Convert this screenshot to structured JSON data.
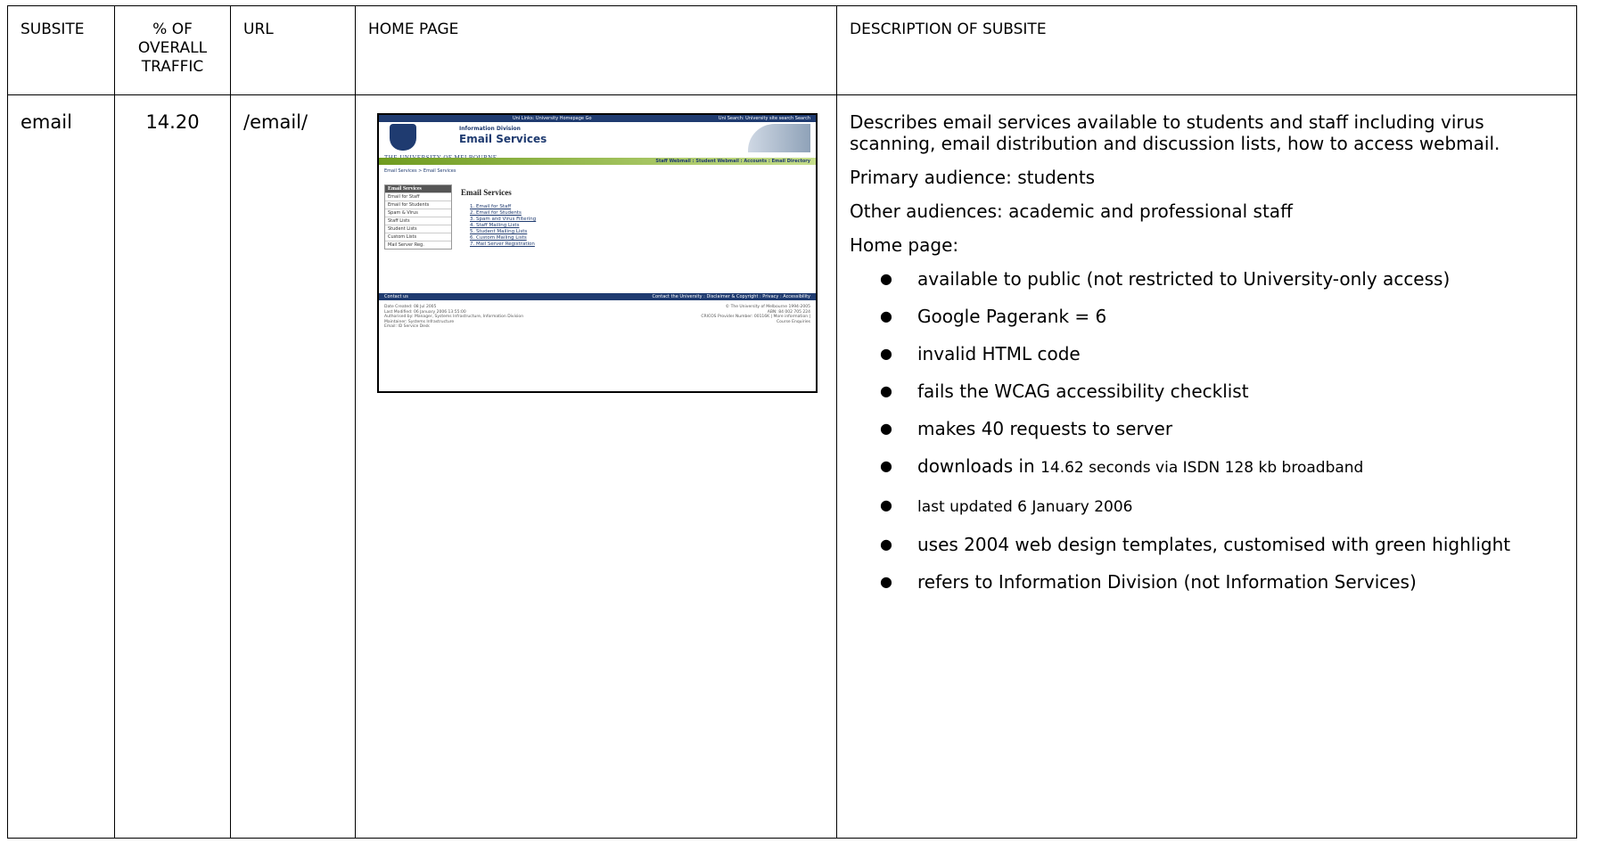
{
  "headers": {
    "subsite": "SUBSITE",
    "traffic_line1": "% OF",
    "traffic_line2": "OVERALL",
    "traffic_line3": "TRAFFIC",
    "url": "URL",
    "home_page": "HOME PAGE",
    "description": "DESCRIPTION OF SUBSITE"
  },
  "row": {
    "subsite": "email",
    "traffic": "14.20",
    "url": "/email/",
    "description": {
      "intro": "Describes email services available to students and staff including virus scanning, email distribution and discussion lists, how to access webmail.",
      "primary": "Primary audience: students",
      "other": "Other audiences: academic and professional staff",
      "home_label": "Home page:",
      "bullets": [
        "available to public (not restricted to University-only access)",
        "Google Pagerank = 6",
        "invalid HTML code",
        "fails the WCAG accessibility checklist",
        "makes 40 requests to server"
      ],
      "download_prefix": "downloads in",
      "download_detail": "14.62 seconds via ISDN 128 kb broadband",
      "last_updated": "last updated 6 January 2006",
      "bullets_after": [
        "uses 2004 web design templates, customised with green highlight",
        "refers to Information Division (not Information Services)"
      ],
      "bullet_glyph": "●"
    }
  },
  "screenshot": {
    "uni_links": "Uni Links: University Homepage  Go",
    "uni_search": "Uni Search: University site search  Search",
    "unimel": "THE UNIVERSITY OF MELBOURNE",
    "division": "Information Division",
    "title": "Email Services",
    "green_links": "Staff Webmail : Student Webmail : Accounts : Email Directory",
    "breadcrumb": "Email Services > Email Services",
    "sidebar_head": "Email Services",
    "sidebar_items": [
      "Email for Staff",
      "Email for Students",
      "Spam & Virus",
      "Staff Lists",
      "Student Lists",
      "Custom Lists",
      "Mail Server Reg."
    ],
    "main_title": "Email Services",
    "main_list": [
      "1. Email for Staff",
      "2. Email for Students",
      "3. Spam and Virus Filtering",
      "4. Staff Mailing Lists",
      "5. Student Mailing Lists",
      "6. Custom Mailing Lists",
      "7. Mail Server Registration"
    ],
    "footer_left": "Contact us",
    "footer_right": "Contact the University : Disclaimer & Copyright : Privacy : Accessibility",
    "meta_lines": [
      "Date Created: 08 Jul 2005",
      "Last Modified: 06 January 2006 13:55:00",
      "Authorised by: Manager, Systems Infrastructure, Information Division",
      "Maintainer: Systems Infrastructure",
      "Email: ID Service Desk"
    ],
    "meta_right_lines": [
      "© The University of Melbourne 1994-2005",
      "ABN: 84 002 705 224",
      "CRICOS Provider Number: 00116K | More information |",
      "Course Enquiries"
    ]
  }
}
